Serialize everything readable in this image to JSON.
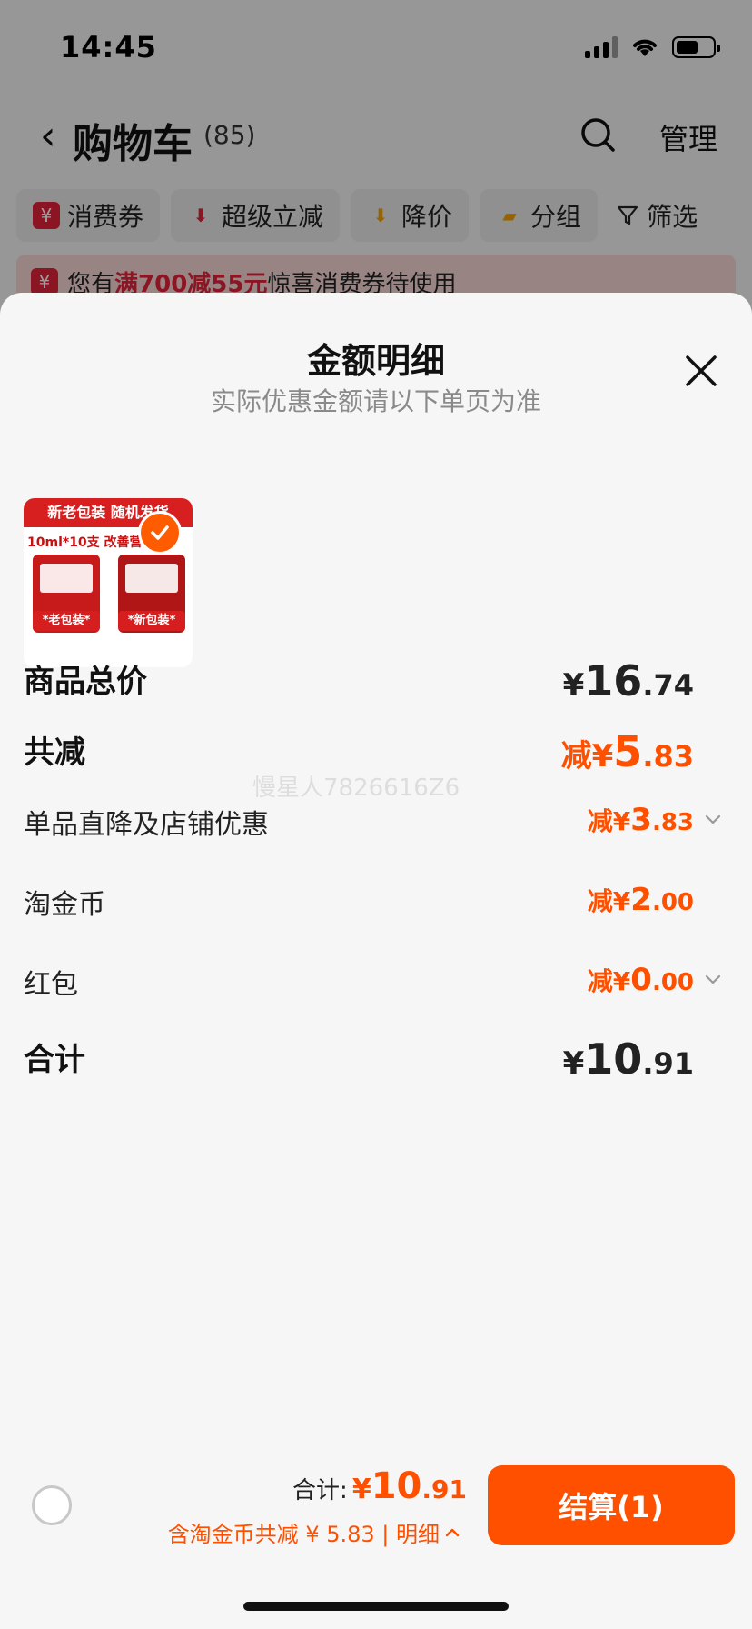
{
  "status_bar": {
    "time": "14:45"
  },
  "nav": {
    "title": "购物车",
    "count": "(85)",
    "manage": "管理"
  },
  "filters": [
    {
      "label": "消费券",
      "icon": "yuan-coupon-icon",
      "color": "#e2233a",
      "glyph": "¥"
    },
    {
      "label": "超级立减",
      "icon": "arrow-down-icon",
      "color": "#e2233a",
      "glyph": "⬇"
    },
    {
      "label": "降价",
      "icon": "price-drop-icon",
      "color": "#f0a000",
      "glyph": "⬇"
    },
    {
      "label": "分组",
      "icon": "folder-icon",
      "color": "#f0a000",
      "glyph": "▰"
    },
    {
      "label": "筛选",
      "icon": "filter-icon",
      "color": "",
      "glyph": ""
    }
  ],
  "coupon_bar": {
    "prefix": "您有",
    "highlight": "满700减55元",
    "suffix": "惊喜消费券待使用"
  },
  "sheet": {
    "title": "金额明细",
    "subtitle": "实际优惠金额请以下单页为准",
    "product": {
      "banner": "新老包装 随机发货",
      "line": "10ml*10支 改善营养",
      "old_pack": "*老包装*",
      "new_pack": "*新包装*",
      "selected": true
    },
    "watermark": "慢星人7826616Z6",
    "rows": {
      "total_price": {
        "label": "商品总价",
        "prefix": "",
        "symbol": "¥",
        "int": "16",
        "dec": ".74"
      },
      "total_discount": {
        "label": "共减",
        "prefix": "减",
        "symbol": "¥",
        "int": "5",
        "dec": ".83"
      },
      "item_discount": {
        "label": "单品直降及店铺优惠",
        "prefix": "减",
        "symbol": "¥",
        "int": "3",
        "dec": ".83"
      },
      "gold_coins": {
        "label": "淘金币",
        "prefix": "减",
        "symbol": "¥",
        "int": "2",
        "dec": ".00"
      },
      "red_packet": {
        "label": "红包",
        "prefix": "减",
        "symbol": "¥",
        "int": "0",
        "dec": ".00"
      },
      "grand_total": {
        "label": "合计",
        "prefix": "",
        "symbol": "¥",
        "int": "10",
        "dec": ".91"
      }
    }
  },
  "footer": {
    "total_label": "合计:",
    "total_symbol": "¥",
    "total_int": "10",
    "total_dec": ".91",
    "note": "含淘金币共减 ¥ 5.83 | 明细",
    "checkout": "结算(1)"
  },
  "colors": {
    "accent": "#ff5000",
    "red": "#e2233a"
  }
}
